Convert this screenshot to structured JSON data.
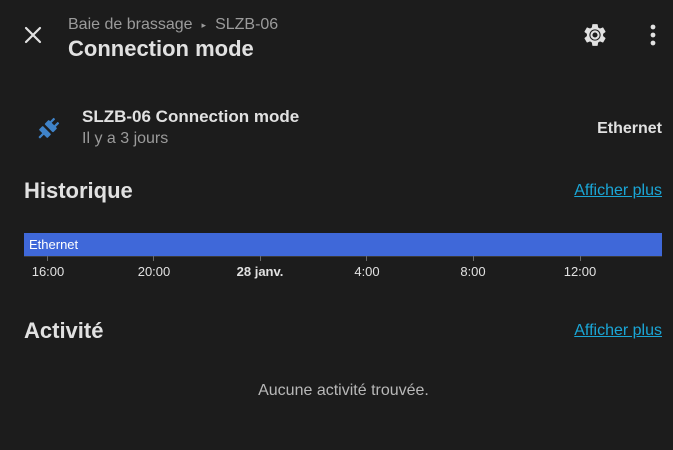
{
  "header": {
    "breadcrumb": [
      "Baie de brassage",
      "SLZB-06"
    ],
    "breadcrumb_separator": "▸",
    "title": "Connection mode"
  },
  "entity": {
    "icon": "ethernet-plug-icon",
    "name": "SLZB-06 Connection mode",
    "last_changed": "Il y a 3 jours",
    "state": "Ethernet"
  },
  "history": {
    "title": "Historique",
    "more_label": "Afficher plus",
    "timeline": {
      "state_label": "Ethernet",
      "color": "#3f68d9",
      "ticks": [
        "16:00",
        "20:00",
        "28 janv.",
        "4:00",
        "8:00",
        "12:00"
      ]
    }
  },
  "activity": {
    "title": "Activité",
    "more_label": "Afficher plus",
    "empty_text": "Aucune activité trouvée."
  },
  "colors": {
    "background": "#1c1c1c",
    "accent_link": "#1aa6d6",
    "icon_blue": "#3f83c9"
  }
}
